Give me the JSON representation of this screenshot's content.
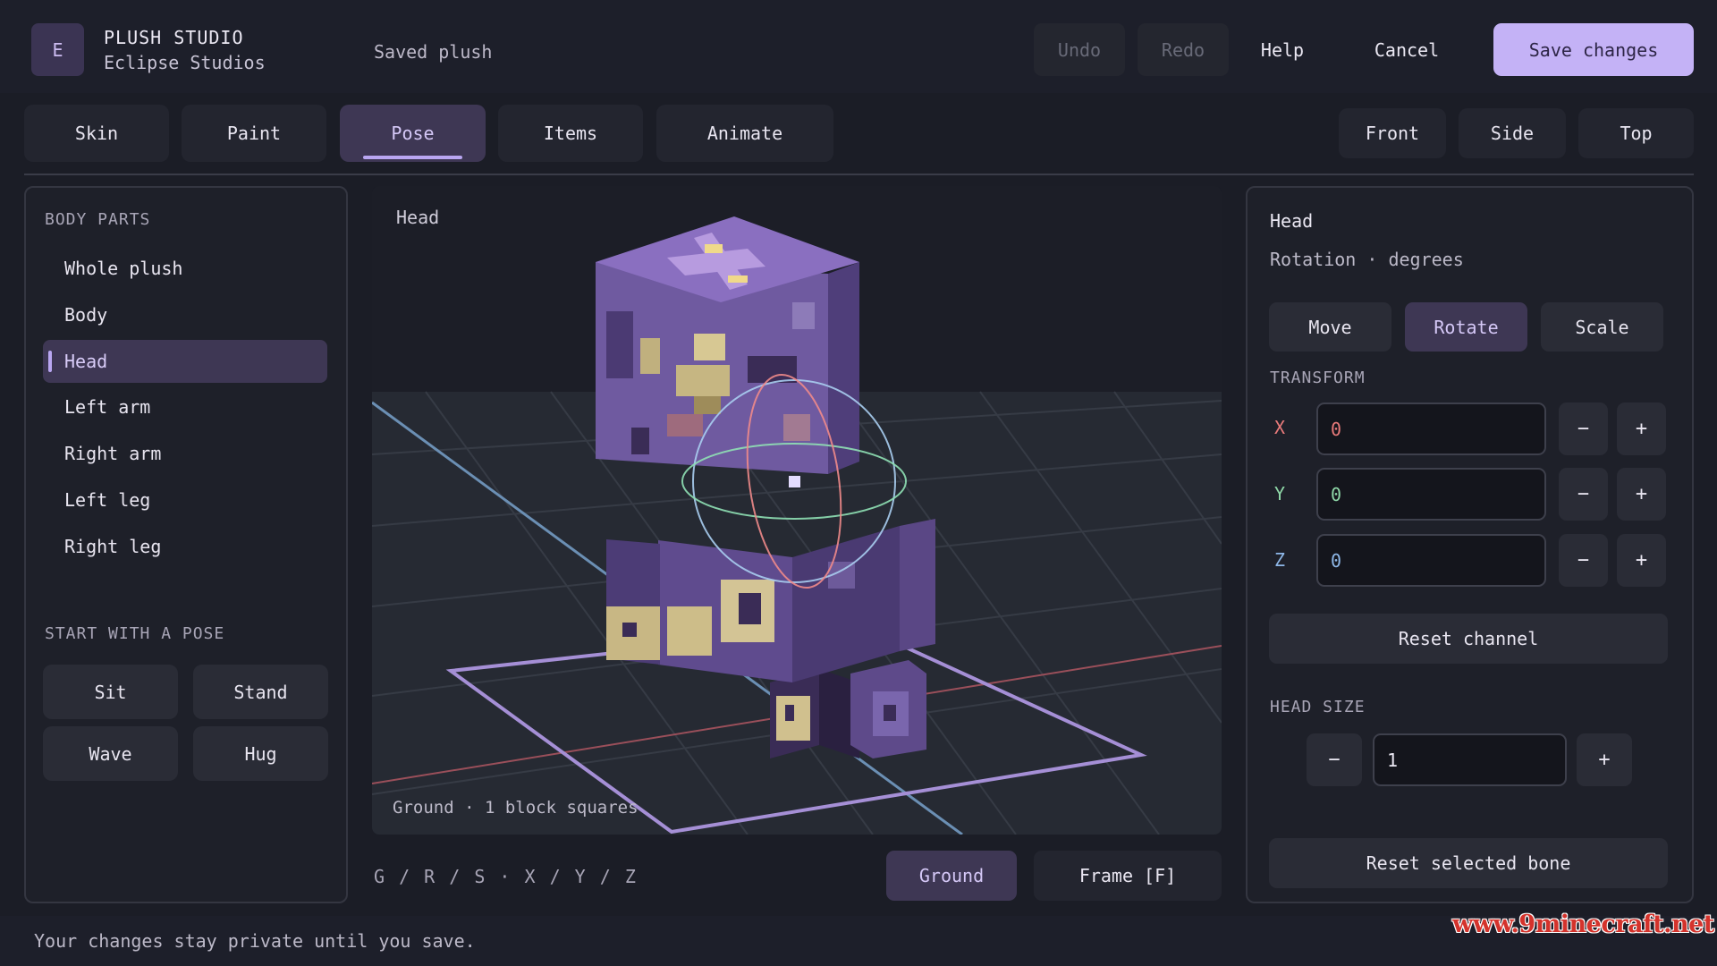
{
  "header": {
    "logo_letter": "E",
    "app_title": "PLUSH STUDIO",
    "app_subtitle": "Eclipse Studios",
    "save_status": "Saved plush",
    "undo_label": "Undo",
    "redo_label": "Redo",
    "help_label": "Help",
    "cancel_label": "Cancel",
    "save_label": "Save changes"
  },
  "tabs": [
    {
      "label": "Skin"
    },
    {
      "label": "Paint"
    },
    {
      "label": "Pose",
      "active": true
    },
    {
      "label": "Items"
    },
    {
      "label": "Animate"
    }
  ],
  "views": [
    {
      "label": "Front"
    },
    {
      "label": "Side"
    },
    {
      "label": "Top"
    }
  ],
  "left_panel": {
    "body_parts_title": "BODY PARTS",
    "body_parts": [
      {
        "label": "Whole plush"
      },
      {
        "label": "Body"
      },
      {
        "label": "Head",
        "active": true
      },
      {
        "label": "Left arm"
      },
      {
        "label": "Right arm"
      },
      {
        "label": "Left leg"
      },
      {
        "label": "Right leg"
      }
    ],
    "poses_title": "START WITH A POSE",
    "poses": [
      {
        "label": "Sit"
      },
      {
        "label": "Stand"
      },
      {
        "label": "Wave"
      },
      {
        "label": "Hug"
      }
    ]
  },
  "viewport": {
    "selected_label": "Head",
    "ground_note": "Ground · 1 block squares",
    "shortcuts": "G / R / S  ·  X / Y / Z",
    "ground_button": "Ground",
    "frame_button": "Frame [F]"
  },
  "right_panel": {
    "title": "Head",
    "subtitle": "Rotation · degrees",
    "modes": [
      {
        "label": "Move"
      },
      {
        "label": "Rotate",
        "active": true
      },
      {
        "label": "Scale"
      }
    ],
    "transform_title": "TRANSFORM",
    "axes": [
      {
        "label": "X",
        "value": "0",
        "color": "#e87a7a"
      },
      {
        "label": "Y",
        "value": "0",
        "color": "#8fd8a8"
      },
      {
        "label": "Z",
        "value": "0",
        "color": "#8fb8e8"
      }
    ],
    "minus_label": "−",
    "plus_label": "+",
    "reset_channel_label": "Reset channel",
    "head_size_title": "HEAD SIZE",
    "head_size_value": "1",
    "reset_bone_label": "Reset selected bone"
  },
  "footer": {
    "note": "Your changes stay private until you save.",
    "watermark": "www.9minecraft.net"
  },
  "colors": {
    "accent": "#c4b2f6",
    "active_bg": "#3e3754",
    "panel_bg": "#1e2029",
    "app_bg": "#1b1d26"
  }
}
